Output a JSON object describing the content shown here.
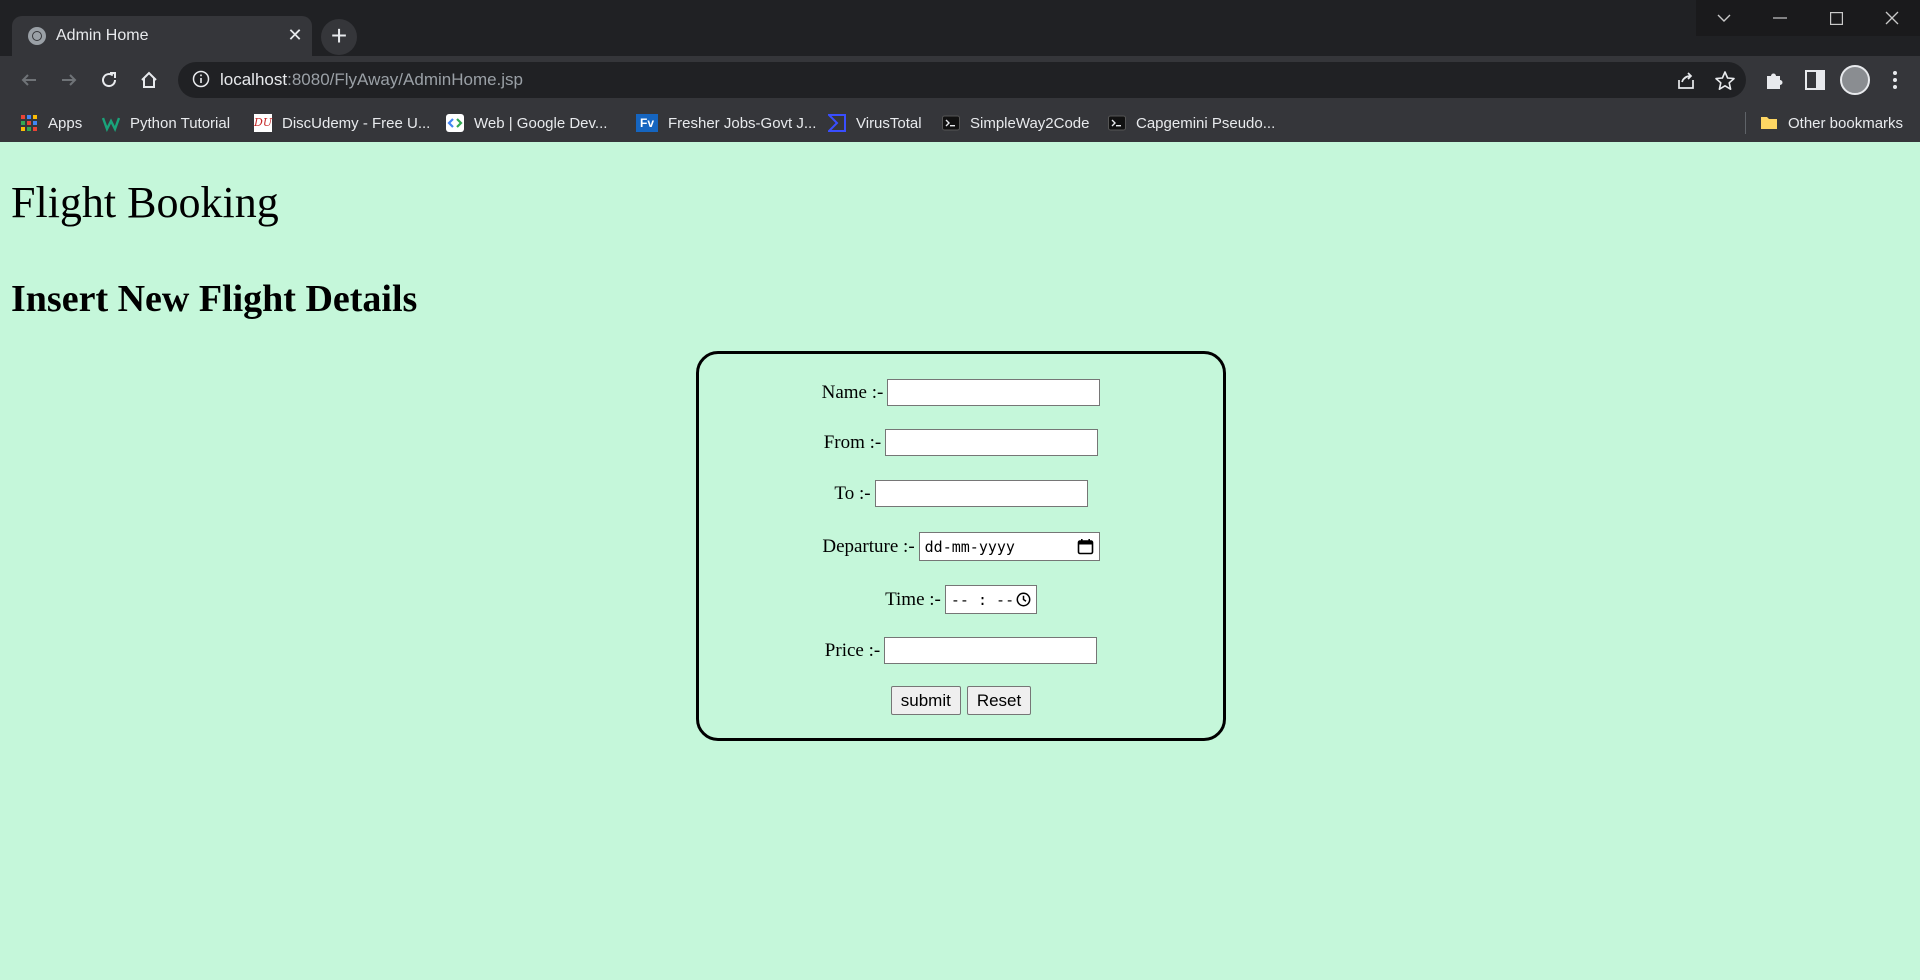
{
  "browser": {
    "tab_title": "Admin Home",
    "url_host": "localhost",
    "url_rest": ":8080/FlyAway/AdminHome.jsp"
  },
  "bookmarks": {
    "items": [
      {
        "label": "Apps",
        "icon": "apps-grid-icon"
      },
      {
        "label": "Python Tutorial",
        "icon": "python-tutorial-favicon"
      },
      {
        "label": "DiscUdemy - Free U...",
        "icon": "discudemy-favicon"
      },
      {
        "label": "Web  |  Google Dev...",
        "icon": "google-developers-favicon"
      },
      {
        "label": "Fresher Jobs-Govt J...",
        "icon": "fresher-jobs-favicon"
      },
      {
        "label": "VirusTotal",
        "icon": "virustotal-favicon"
      },
      {
        "label": "SimpleWay2Code",
        "icon": "terminal-favicon"
      },
      {
        "label": "Capgemini Pseudo...",
        "icon": "terminal-favicon"
      }
    ],
    "other": "Other bookmarks"
  },
  "page": {
    "heading": "Flight Booking",
    "subheading": "Insert New Flight Details"
  },
  "form": {
    "name_label": "Name :-",
    "from_label": "From :-",
    "to_label": "To :-",
    "departure_label": "Departure :-",
    "departure_placeholder": "dd-mm-yyyy",
    "time_label": "Time :-",
    "time_placeholder": "-- : --",
    "price_label": "Price :-",
    "submit_label": "submit",
    "reset_label": "Reset"
  },
  "colors": {
    "page_background": "#c5f7da",
    "browser_chrome": "#35363a"
  }
}
